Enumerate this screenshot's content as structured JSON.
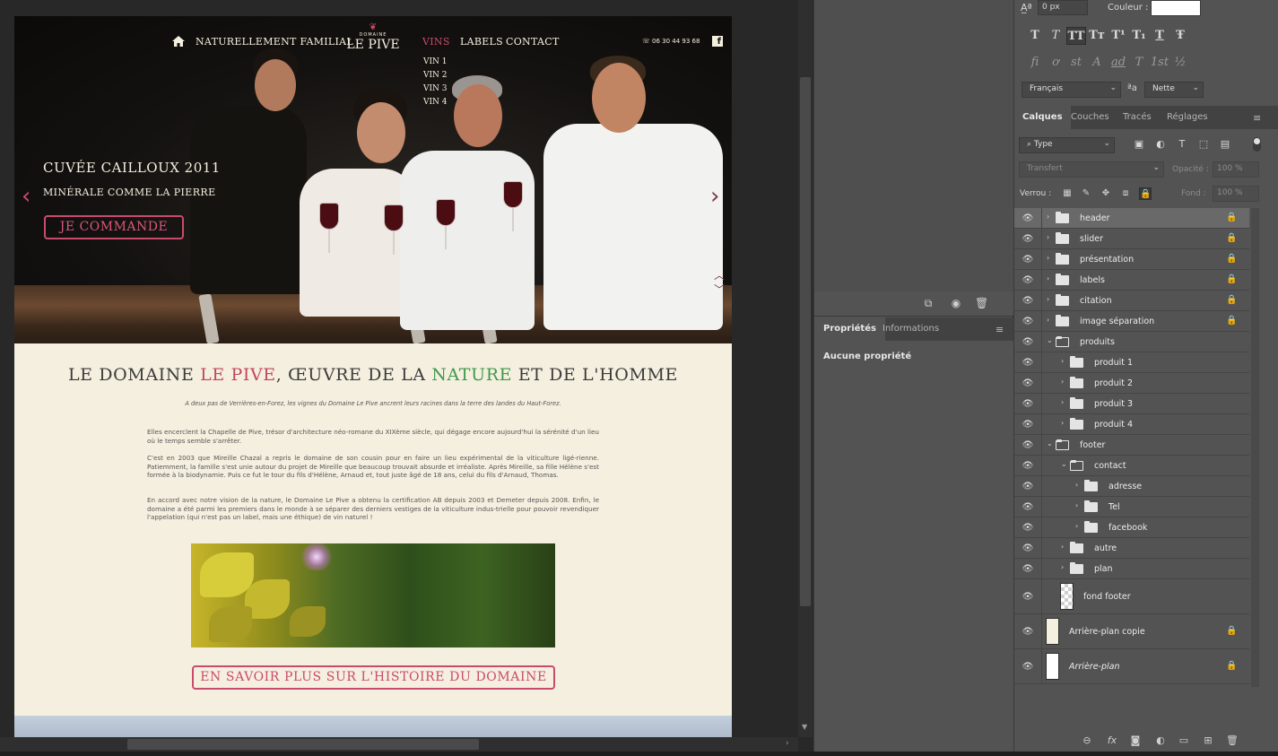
{
  "site": {
    "nav": {
      "tagline": "NATURELLEMENT FAMILIAL",
      "vins": "VINS",
      "labels": "LABELS",
      "contact": "CONTACT"
    },
    "logo": {
      "small": "DOMAINE",
      "big": "LE PIVE"
    },
    "submenu": [
      "VIN 1",
      "VIN 2",
      "VIN 3",
      "VIN 4"
    ],
    "phone": "06 30 44 93 68",
    "hero": {
      "title": "CUVÉE CAILLOUX 2011",
      "subtitle": "MINÉRALE COMME LA PIERRE",
      "cta": "JE COMMANDE"
    },
    "section": {
      "title_a": "LE DOMAINE ",
      "title_b": "LE PIVE",
      "title_c": ", ŒUVRE DE LA ",
      "title_d": "NATURE",
      "title_e": " ET DE L'HOMME",
      "intro": "A deux pas de Verrières-en-Forez, les vignes du Domaine Le Pive ancrent leurs racines dans la terre des landes du Haut-Forez.",
      "p1": "Elles encerclent la Chapelle de Pive, trésor d'architecture néo-romane du XIXème siècle, qui dégage encore aujourd'hui la sérénité d'un lieu où le temps semble s'arrêter.",
      "p2": "C'est en 2003 que Mireille Chazal a repris le domaine de son cousin pour en faire un lieu expérimental de la viticulture ligé-rienne. Patiemment, la famille s'est unie autour du projet de Mireille que beaucoup trouvait absurde et irréaliste. Après Mireille, sa fille Hélène s'est formée à la biodynamie. Puis ce fut le tour du fils d'Hélène, Arnaud et, tout juste âgé de 18 ans, celui du fils d'Arnaud, Thomas.",
      "p3": "En accord avec notre vision de la nature, le Domaine Le Pive a obtenu la certification AB depuis 2003 et Demeter depuis 2008. Enfin, le domaine a été parmi les premiers dans le monde à se séparer des derniers vestiges de la viticulture indus-trielle pour pouvoir revendiquer l'appelation (qui n'est pas un label, mais une éthique) de vin naturel !",
      "cta": "EN SAVOIR PLUS SUR L'HISTOIRE DU DOMAINE"
    }
  },
  "properties": {
    "tabs": [
      "Propriétés",
      "Informations"
    ],
    "empty": "Aucune propriété"
  },
  "character": {
    "tracking": "0 px",
    "color_label": "Couleur :",
    "color_value": "#ffffff",
    "language": "Français",
    "antialias": "Nette",
    "row1": [
      "T",
      "T",
      "TT",
      "Tт",
      "T¹",
      "T₁",
      "T",
      "Ŧ"
    ],
    "row2": [
      "fi",
      "ơ",
      "st",
      "A",
      "ad",
      "T",
      "1st",
      "½"
    ]
  },
  "layers": {
    "tabs": [
      "Calques",
      "Couches",
      "Tracés",
      "Réglages"
    ],
    "filter": "Type",
    "blend": "Transfert",
    "opacity_label": "Opacité :",
    "opacity": "100 %",
    "lock_label": "Verrou :",
    "fill_label": "Fond :",
    "fill": "100 %",
    "items": [
      {
        "name": "header"
      },
      {
        "name": "slider"
      },
      {
        "name": "présentation"
      },
      {
        "name": "labels"
      },
      {
        "name": "citation"
      },
      {
        "name": "image séparation"
      },
      {
        "name": "produits"
      },
      {
        "name": "produit 1"
      },
      {
        "name": "produit 2"
      },
      {
        "name": "produit 3"
      },
      {
        "name": "produit 4"
      },
      {
        "name": "footer"
      },
      {
        "name": "contact"
      },
      {
        "name": "adresse"
      },
      {
        "name": "Tel"
      },
      {
        "name": "facebook"
      },
      {
        "name": "autre"
      },
      {
        "name": "plan"
      },
      {
        "name": "fond footer"
      },
      {
        "name": "Arrière-plan copie"
      },
      {
        "name": "Arrière-plan"
      }
    ]
  },
  "colors": {
    "accent": "#c94b6b",
    "nature_green": "#3e9a4a",
    "panel": "#535353",
    "page_bg": "#f5efdf"
  }
}
